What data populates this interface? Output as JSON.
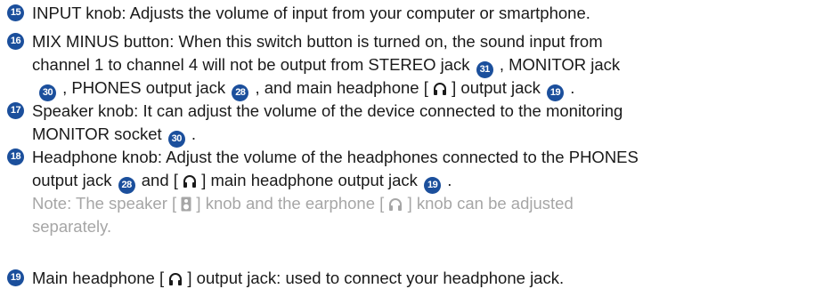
{
  "items": [
    {
      "number": "15",
      "lines": [
        "INPUT knob: Adjusts the volume of input from your computer or smartphone."
      ]
    },
    {
      "number": "16",
      "line1": "MIX MINUS button: When this switch button is turned on, the sound input from",
      "line2_a": "channel 1 to channel 4 will not be output from STEREO jack",
      "line2_ref": "31",
      "line2_b": ", MONITOR jack",
      "line3_ref1": "30",
      "line3_a": ", PHONES output jack",
      "line3_ref2": "28",
      "line3_b": ", and main headphone [",
      "line3_c": "] output jack",
      "line3_ref3": "19",
      "line3_end": "."
    },
    {
      "number": "17",
      "line1": "Speaker knob: It can adjust the volume of the device connected to the monitoring",
      "line2_a": "MONITOR socket",
      "line2_ref": "30",
      "line2_end": "."
    },
    {
      "number": "18",
      "line1": "Headphone knob: Adjust the volume of the headphones connected to the PHONES",
      "line2_a": "output jack",
      "line2_ref1": "28",
      "line2_b": "and [",
      "line2_c": "] main headphone output jack",
      "line2_ref2": "19",
      "line2_end": ".",
      "note1_a": "Note: The speaker [",
      "note1_b": "] knob and the earphone [",
      "note1_c": "] knob can be adjusted",
      "note2": "separately."
    },
    {
      "number": "19",
      "line1_a": "Main headphone [",
      "line1_b": "] output jack: used to connect your headphone jack."
    }
  ],
  "colors": {
    "badge": "#1b4f9c",
    "text": "#1a1a1a",
    "note": "#a6a6a6"
  },
  "icons": {
    "headphone": "headphone-icon",
    "speaker": "speaker-icon"
  }
}
